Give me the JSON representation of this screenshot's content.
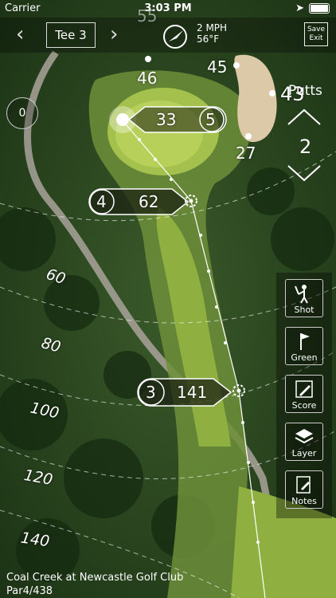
{
  "status": {
    "carrier": "Carrier",
    "time": "3:03 PM"
  },
  "nav": {
    "tee": "Tee 3"
  },
  "weather": {
    "wind": "2 MPH",
    "temp": "56°F"
  },
  "save": {
    "line1": "Save",
    "line2": "Exit"
  },
  "map": {
    "yardages": {
      "back_top": "55",
      "back": "46",
      "bunker_front": "45",
      "bunker_back": "43",
      "bunker_carry": "27"
    },
    "callouts": [
      {
        "club": "5",
        "distance": "33"
      },
      {
        "club": "4",
        "distance": "62"
      },
      {
        "club": "3",
        "distance": "141"
      }
    ],
    "arcs": [
      "60",
      "80",
      "100",
      "120",
      "140"
    ]
  },
  "putts": {
    "label": "Putts",
    "count": "2"
  },
  "tools": [
    {
      "label": "Shot",
      "icon": "golfer-icon"
    },
    {
      "label": "Green",
      "icon": "flag-icon"
    },
    {
      "label": "Score",
      "icon": "pencil-icon"
    },
    {
      "label": "Layer",
      "icon": "layers-icon"
    },
    {
      "label": "Notes",
      "icon": "notes-icon"
    }
  ],
  "compass": {
    "value": "0"
  },
  "footer": {
    "course": "Coal Creek at Newcastle Golf Club",
    "hole": "Par4/438"
  }
}
